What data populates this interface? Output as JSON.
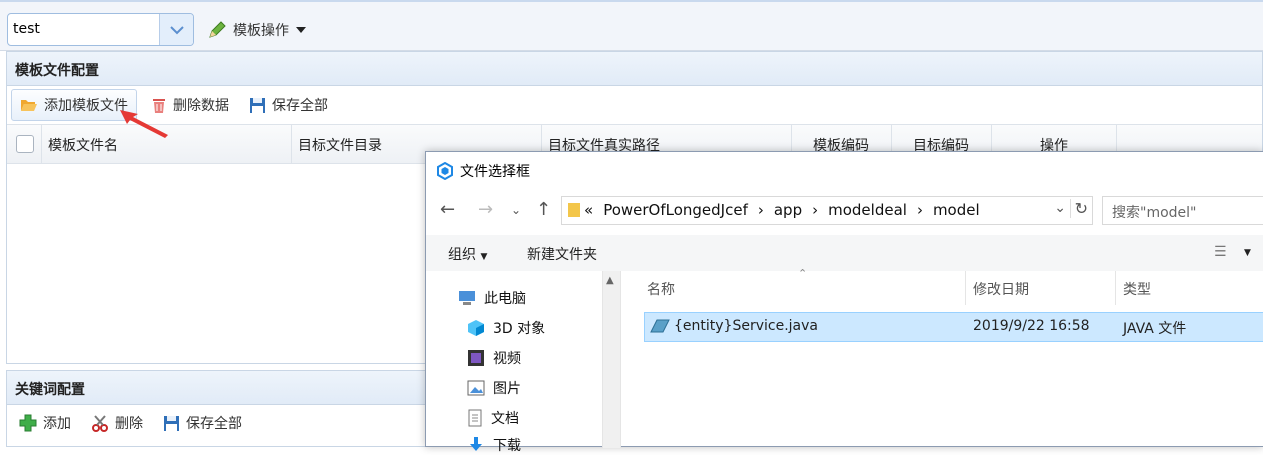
{
  "topbar": {
    "template_select_value": "test",
    "template_ops_label": "模板操作"
  },
  "template_panel": {
    "title": "模板文件配置",
    "toolbar": {
      "add_label": "添加模板文件",
      "delete_label": "删除数据",
      "save_label": "保存全部"
    },
    "columns": [
      "模板文件名",
      "目标文件目录",
      "目标文件真实路径",
      "模板编码",
      "目标编码",
      "操作"
    ]
  },
  "keyword_panel": {
    "title": "关键词配置",
    "toolbar": {
      "add_label": "添加",
      "delete_label": "删除",
      "save_label": "保存全部"
    }
  },
  "dialog": {
    "title": "文件选择框",
    "breadcrumb_prefix": "«",
    "breadcrumb": [
      "PowerOfLongedJcef",
      "app",
      "modeldeal",
      "model"
    ],
    "search_placeholder": "搜索\"model\"",
    "commands": {
      "organize_label": "组织",
      "new_folder_label": "新建文件夹"
    },
    "nav_items": [
      "此电脑",
      "3D 对象",
      "视频",
      "图片",
      "文档",
      "下载"
    ],
    "file_columns": {
      "name": "名称",
      "modified": "修改日期",
      "type": "类型"
    },
    "files": [
      {
        "name": "{entity}Service.java",
        "modified": "2019/9/22 16:58",
        "type": "JAVA 文件"
      }
    ]
  },
  "colors": {
    "accent_blue": "#2b7bd8",
    "selection": "#cce8ff",
    "annotation_red": "#e53935"
  }
}
